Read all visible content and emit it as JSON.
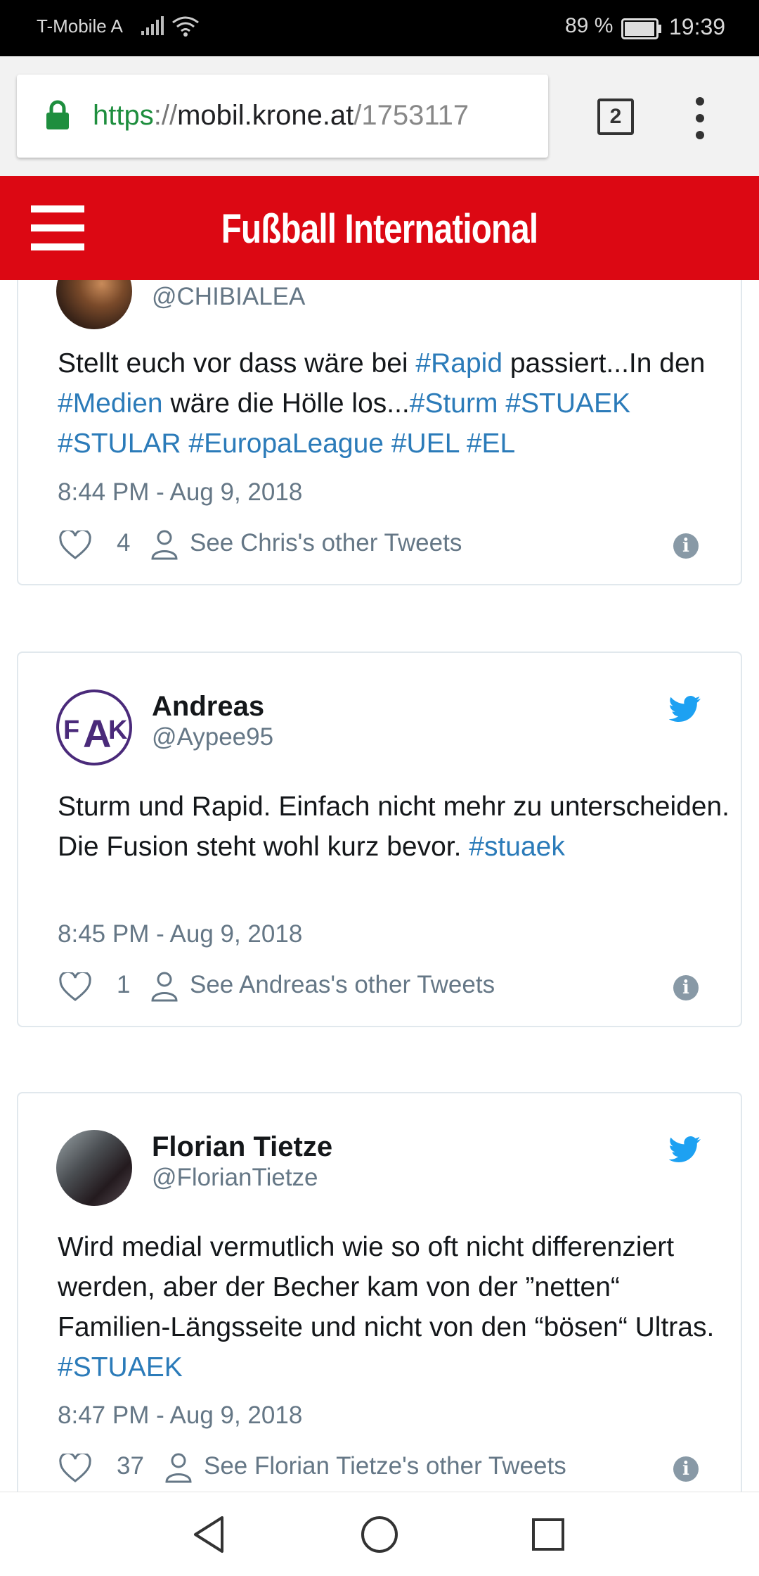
{
  "status_bar": {
    "carrier": "T-Mobile A",
    "battery": "89 %",
    "time": "19:39"
  },
  "browser": {
    "url_scheme": "https",
    "url_sep": "://",
    "url_host": "mobil.krone.at",
    "url_path": "/1753117",
    "tab_count": "2"
  },
  "site": {
    "title": "Fußball International"
  },
  "tweets": [
    {
      "name": "",
      "handle": "@CHIBIALEA",
      "text": [
        {
          "t": "Stellt euch vor dass wäre bei ",
          "tag": false
        },
        {
          "t": "#Rapid",
          "tag": true
        },
        {
          "t": " passiert...In den ",
          "tag": false
        },
        {
          "t": "#Medien",
          "tag": true
        },
        {
          "t": " wäre die Hölle los...",
          "tag": false
        },
        {
          "t": "#Sturm",
          "tag": true
        },
        {
          "t": " ",
          "tag": false
        },
        {
          "t": "#STUAEK",
          "tag": true
        },
        {
          "t": " ",
          "tag": false
        },
        {
          "t": "#STULAR",
          "tag": true
        },
        {
          "t": " ",
          "tag": false
        },
        {
          "t": "#EuropaLeague",
          "tag": true
        },
        {
          "t": " ",
          "tag": false
        },
        {
          "t": "#UEL",
          "tag": true
        },
        {
          "t": " ",
          "tag": false
        },
        {
          "t": "#EL",
          "tag": true
        }
      ],
      "date": "8:44 PM - Aug 9, 2018",
      "likes": "4",
      "other_tweets": "See Chris's other Tweets"
    },
    {
      "name": "Andreas",
      "handle": "@Aypee95",
      "text": [
        {
          "t": "Sturm und Rapid. Einfach nicht mehr zu unterscheiden. Die Fusion steht wohl kurz bevor. ",
          "tag": false
        },
        {
          "t": "#stuaek",
          "tag": true
        }
      ],
      "date": "8:45 PM - Aug 9, 2018",
      "likes": "1",
      "other_tweets": "See Andreas's other Tweets"
    },
    {
      "name": "Florian Tietze",
      "handle": "@FlorianTietze",
      "text": [
        {
          "t": "Wird medial vermutlich wie so oft nicht differenziert werden, aber der Becher kam von der ”netten“ Familien-Längsseite und nicht von den “bösen“ Ultras. ",
          "tag": false
        },
        {
          "t": "#STUAEK",
          "tag": true
        }
      ],
      "date": "8:47 PM - Aug 9, 2018",
      "likes": "37",
      "other_tweets": "See Florian Tietze's other Tweets"
    }
  ],
  "avatar_text": {
    "fak": "FAK"
  },
  "colors": {
    "brand_red": "#dc0813",
    "hashtag_blue": "#2b7bb9",
    "twitter_blue": "#1da1f2",
    "secure_green": "#1e8e3e"
  },
  "icons": {
    "lock": "lock-icon",
    "tabs": "tabs-icon",
    "menu": "more-vert-icon",
    "hamburger": "hamburger-menu-icon",
    "bird": "twitter-bird-icon",
    "heart": "heart-icon",
    "user": "user-icon",
    "info": "info-icon",
    "back": "back-icon",
    "home": "home-icon",
    "recent": "recent-apps-icon"
  }
}
